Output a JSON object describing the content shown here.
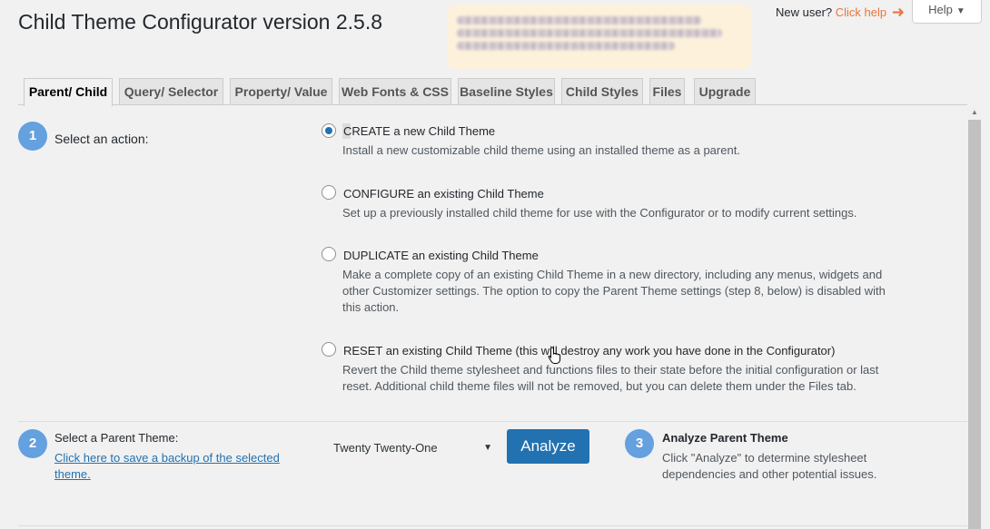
{
  "header": {
    "title": "Child Theme Configurator version 2.5.8",
    "new_user_text": "New user?",
    "click_help_link": "Click help",
    "help_button": "Help"
  },
  "tabs": [
    {
      "label": "Parent/ Child",
      "active": true
    },
    {
      "label": "Query/ Selector"
    },
    {
      "label": "Property/ Value"
    },
    {
      "label": "Web Fonts & CSS"
    },
    {
      "label": "Baseline Styles"
    },
    {
      "label": "Child Styles"
    },
    {
      "label": "Files"
    },
    {
      "label": "Upgrade"
    }
  ],
  "step1": {
    "number": "1",
    "label": "Select an action:",
    "options": [
      {
        "title": "CREATE a new Child Theme",
        "desc": "Install a new customizable child theme using an installed theme as a parent.",
        "checked": true
      },
      {
        "title": "CONFIGURE an existing Child Theme",
        "desc": "Set up a previously installed child theme for use with the Configurator or to modify current settings."
      },
      {
        "title": "DUPLICATE an existing Child Theme",
        "desc": "Make a complete copy of an existing Child Theme in a new directory, including any menus, widgets and other Customizer settings. The option to copy the Parent Theme settings (step 8, below) is disabled with this action."
      },
      {
        "title": "RESET an existing Child Theme (this will destroy any work you have done in the Configurator)",
        "desc": "Revert the Child theme stylesheet and functions files to their state before the initial configuration or last reset. Additional child theme files will not be removed, but you can delete them under the Files tab."
      }
    ]
  },
  "step2": {
    "number": "2",
    "label": "Select a Parent Theme:",
    "backup_link": "Click here to save a backup of the selected theme.",
    "selected_theme": "Twenty Twenty-One",
    "analyze_button": "Analyze"
  },
  "step3": {
    "number": "3",
    "label": "Analyze Parent Theme",
    "desc": "Click \"Analyze\" to determine stylesheet dependencies and other potential issues."
  },
  "colors": {
    "accent": "#2271b1",
    "step_badge": "#65a0df",
    "help_link": "#e9753c"
  }
}
